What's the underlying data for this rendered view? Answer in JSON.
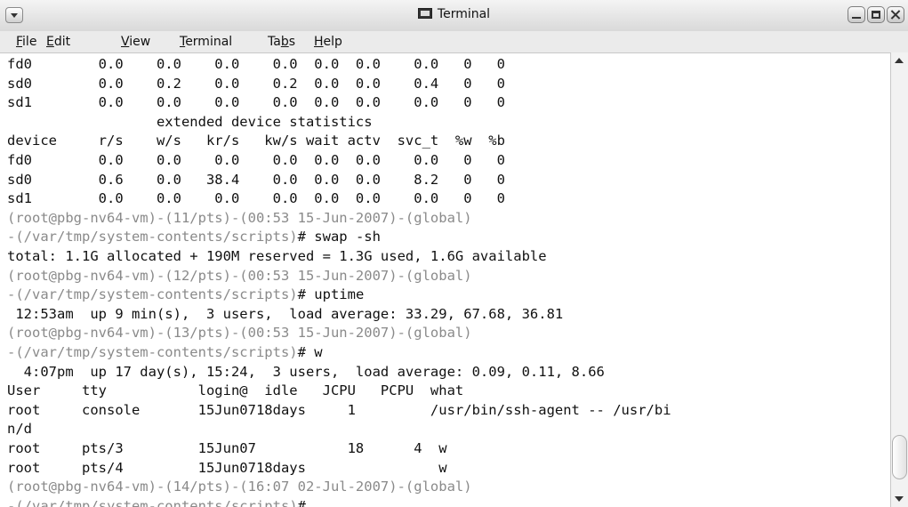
{
  "window": {
    "title": "Terminal"
  },
  "menu": {
    "file": {
      "accel": "F",
      "rest": "ile"
    },
    "edit": {
      "accel": "E",
      "rest": "dit"
    },
    "view": {
      "accel": "V",
      "rest": "iew"
    },
    "terminal": {
      "accel": "T",
      "rest": "erminal"
    },
    "tabs": {
      "pre": "Ta",
      "accel": "b",
      "rest": "s"
    },
    "help": {
      "accel": "H",
      "rest": "elp"
    }
  },
  "lines": [
    "fd0        0.0    0.0    0.0    0.0  0.0  0.0    0.0   0   0",
    "sd0        0.0    0.2    0.0    0.2  0.0  0.0    0.4   0   0",
    "sd1        0.0    0.0    0.0    0.0  0.0  0.0    0.0   0   0",
    "                  extended device statistics",
    "device     r/s    w/s   kr/s   kw/s wait actv  svc_t  %w  %b",
    "fd0        0.0    0.0    0.0    0.0  0.0  0.0    0.0   0   0",
    "sd0        0.6    0.0   38.4    0.0  0.0  0.0    8.2   0   0",
    "sd1        0.0    0.0    0.0    0.0  0.0  0.0    0.0   0   0",
    "(root@pbg-nv64-vm)-(11/pts)-(00:53 15-Jun-2007)-(global)",
    "-(/var/tmp/system-contents/scripts)# swap -sh",
    "total: 1.1G allocated + 190M reserved = 1.3G used, 1.6G available",
    "(root@pbg-nv64-vm)-(12/pts)-(00:53 15-Jun-2007)-(global)",
    "-(/var/tmp/system-contents/scripts)# uptime",
    " 12:53am  up 9 min(s),  3 users,  load average: 33.29, 67.68, 36.81",
    "(root@pbg-nv64-vm)-(13/pts)-(00:53 15-Jun-2007)-(global)",
    "-(/var/tmp/system-contents/scripts)# w",
    "  4:07pm  up 17 day(s), 15:24,  3 users,  load average: 0.09, 0.11, 8.66",
    "User     tty           login@  idle   JCPU   PCPU  what",
    "root     console       15Jun0718days     1         /usr/bin/ssh-agent -- /usr/bi",
    "n/d",
    "root     pts/3         15Jun07           18      4  w",
    "root     pts/4         15Jun0718days                w",
    "(root@pbg-nv64-vm)-(14/pts)-(16:07 02-Jul-2007)-(global)",
    "-(/var/tmp/system-contents/scripts)#"
  ],
  "prompt_lines": [
    8,
    9,
    11,
    12,
    14,
    15,
    22,
    23
  ],
  "prompt_color": "#8a8a8a"
}
